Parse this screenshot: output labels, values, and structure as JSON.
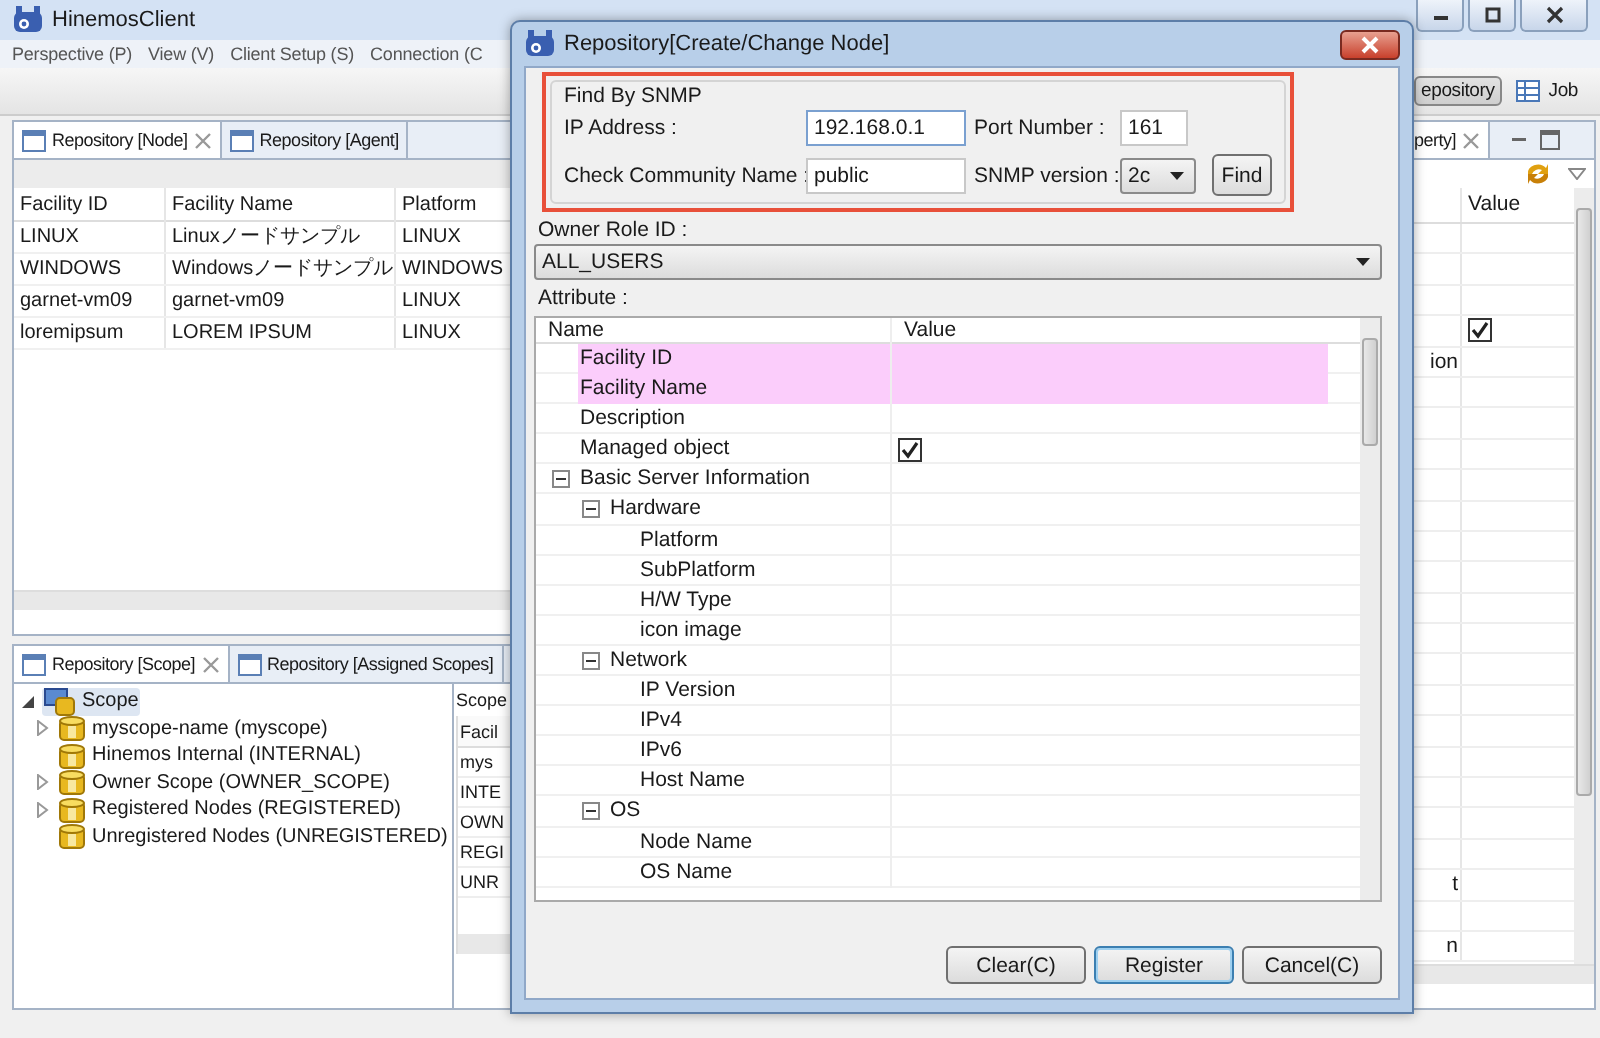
{
  "window": {
    "title": "HinemosClient"
  },
  "menu": [
    "Perspective (P)",
    "View (V)",
    "Client Setup (S)",
    "Connection (C"
  ],
  "perspectives": [
    {
      "label": "epository",
      "selected": true
    },
    {
      "label": "Job",
      "selected": false
    }
  ],
  "node_view": {
    "tabs": [
      {
        "label": "Repository [Node]",
        "selected": true,
        "closable": true
      },
      {
        "label": "Repository [Agent]",
        "selected": false,
        "closable": false
      }
    ],
    "columns": [
      "Facility ID",
      "Facility Name",
      "Platform"
    ],
    "rows": [
      [
        "LINUX",
        "Linuxノードサンプル",
        "LINUX"
      ],
      [
        "WINDOWS",
        "Windowsノードサンプル",
        "WINDOWS"
      ],
      [
        "garnet-vm09",
        "garnet-vm09",
        "LINUX"
      ],
      [
        "loremipsum",
        "LOREM IPSUM",
        "LINUX"
      ]
    ]
  },
  "scope_view": {
    "tabs": [
      {
        "label": "Repository [Scope]",
        "selected": true,
        "closable": true
      },
      {
        "label": "Repository [Assigned Scopes]",
        "selected": false,
        "closable": false
      }
    ],
    "tree": {
      "label": "Scope",
      "expanded": true,
      "selected": true,
      "children": [
        {
          "label": "myscope-name (myscope)",
          "expandable": true
        },
        {
          "label": "Hinemos Internal (INTERNAL)",
          "expandable": false
        },
        {
          "label": "Owner Scope (OWNER_SCOPE)",
          "expandable": true
        },
        {
          "label": "Registered Nodes (REGISTERED)",
          "expandable": true
        },
        {
          "label": "Unregistered Nodes (UNREGISTERED)",
          "expandable": false
        }
      ]
    },
    "list_title": "Scope",
    "list_columns": [
      "Facil"
    ],
    "list_rows": [
      "mys",
      "INTE",
      "OWN",
      "REGI",
      "UNR"
    ]
  },
  "property_view": {
    "tab": "perty]",
    "columns": [
      "Value"
    ],
    "rows": [
      {},
      {},
      {},
      {
        "checked": true
      },
      {
        "name": "ion"
      },
      {},
      {},
      {},
      {},
      {},
      {},
      {},
      {},
      {},
      {},
      {},
      {},
      {},
      {},
      {},
      {},
      {
        "name": "t"
      },
      {},
      {
        "name": "n"
      }
    ]
  },
  "dialog": {
    "title": "Repository[Create/Change Node]",
    "snmp": {
      "title": "Find By SNMP",
      "highlighted": true,
      "ip_label": "IP Address :",
      "ip_value": "192.168.0.1",
      "port_label": "Port Number :",
      "port_value": "161",
      "community_label": "Check Community Name :",
      "community_value": "public",
      "version_label": "SNMP version :",
      "version_value": "2c",
      "find_button": "Find"
    },
    "owner_label": "Owner Role ID :",
    "owner_value": "ALL_USERS",
    "attribute_label": "Attribute :",
    "attribute_columns": [
      "Name",
      "Value"
    ],
    "attributes": [
      {
        "name": "Facility ID",
        "required": true
      },
      {
        "name": "Facility Name",
        "required": true
      },
      {
        "name": "Description",
        "required": false
      },
      {
        "name": "Managed object",
        "required": false,
        "kind": "checkbox",
        "checked": true
      },
      {
        "name": "Basic Server Information",
        "expanded": true,
        "children": [
          {
            "name": "Hardware",
            "expanded": true,
            "children": [
              {
                "name": "Platform"
              },
              {
                "name": "SubPlatform"
              },
              {
                "name": "H/W Type"
              },
              {
                "name": "icon image"
              }
            ]
          },
          {
            "name": "Network",
            "expanded": true,
            "children": [
              {
                "name": "IP Version"
              },
              {
                "name": "IPv4"
              },
              {
                "name": "IPv6"
              },
              {
                "name": "Host Name"
              }
            ]
          },
          {
            "name": "OS",
            "expanded": true,
            "children": [
              {
                "name": "Node Name"
              },
              {
                "name": "OS Name"
              }
            ]
          }
        ]
      }
    ],
    "buttons": [
      {
        "label": "Clear(C)",
        "default": false
      },
      {
        "label": "Register",
        "default": true
      },
      {
        "label": "Cancel(C)",
        "default": false
      }
    ]
  }
}
